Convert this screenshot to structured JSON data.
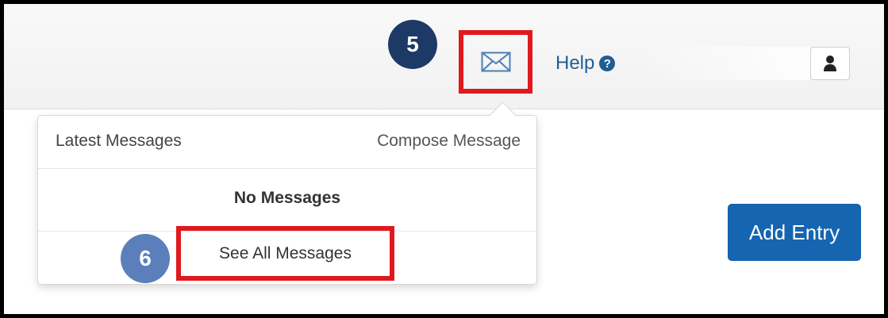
{
  "header": {
    "help_label": "Help",
    "help_icon": "question-circle-icon",
    "mail_icon": "envelope-icon",
    "user_icon": "user-icon"
  },
  "callouts": {
    "step_5": "5",
    "step_6": "6",
    "highlight_color": "#e0191e",
    "badge_5_color": "#1d3a66",
    "badge_6_color": "#5a7fbb"
  },
  "messages_dropdown": {
    "latest_label": "Latest Messages",
    "compose_label": "Compose Message",
    "empty_text": "No Messages",
    "see_all_label": "See All Messages"
  },
  "main": {
    "add_entry_label": "Add Entry",
    "accent_color": "#1565b0"
  }
}
